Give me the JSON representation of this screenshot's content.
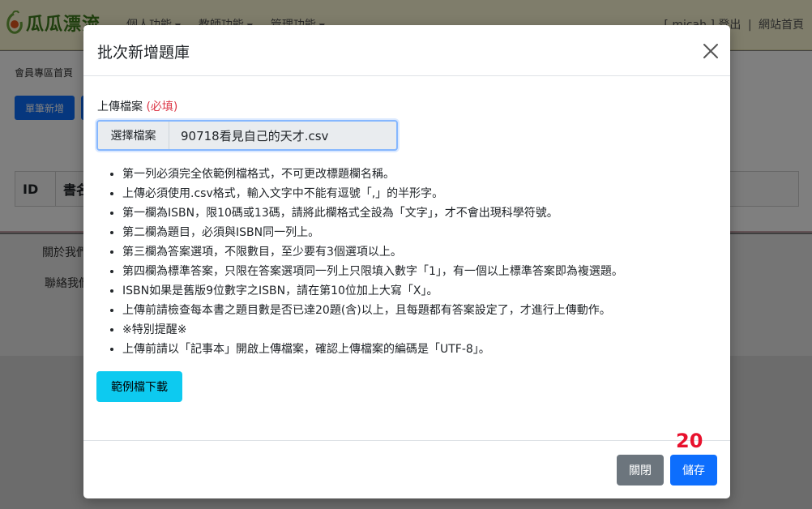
{
  "nav": {
    "brand": "瓜瓜漂流",
    "menu": [
      {
        "label": "個人功能"
      },
      {
        "label": "教師功能"
      },
      {
        "label": "管理功能"
      }
    ],
    "user": "[ micah ]",
    "logout": "登出",
    "site_home": "網站首頁"
  },
  "page": {
    "breadcrumb": "會員專區首頁",
    "single_add": "單筆新增",
    "table_headers": [
      "ID",
      "書名"
    ],
    "footer_links": [
      "關於我們",
      "聯絡我們"
    ]
  },
  "modal": {
    "title": "批次新增題庫",
    "field_label": "上傳檔案",
    "required": "(必填)",
    "file_button": "選擇檔案",
    "file_name": "90718看見自己的天才.csv",
    "rules": [
      "第一列必須完全依範例檔格式，不可更改標題欄名稱。",
      "上傳必須使用.csv格式，輸入文字中不能有逗號「,」的半形字。",
      "第一欄為ISBN，限10碼或13碼，請將此欄格式全設為「文字」，才不會出現科學符號。",
      "第二欄為題目，必須與ISBN同一列上。",
      "第三欄為答案選項，不限數目，至少要有3個選項以上。",
      "第四欄為標準答案，只限在答案選項同一列上只限填入數字「1」，有一個以上標準答案即為複選題。",
      "ISBN如果是舊版9位數字之ISBN，請在第10位加上大寫「X」。",
      "上傳前請檢查每本書之題目數是否已達20題(含)以上，且每題都有答案設定了，才進行上傳動作。",
      "※特別提醒※",
      "上傳前請以「記事本」開啟上傳檔案，確認上傳檔案的編碼是「UTF-8」。"
    ],
    "sample_download": "範例檔下載",
    "close": "關閉",
    "save": "儲存"
  },
  "step_marker": "20",
  "colors": {
    "primary": "#0d6efd",
    "secondary": "#6c757d",
    "info": "#0dcaf0",
    "danger": "#dc3545",
    "marker": "#e8112d"
  }
}
